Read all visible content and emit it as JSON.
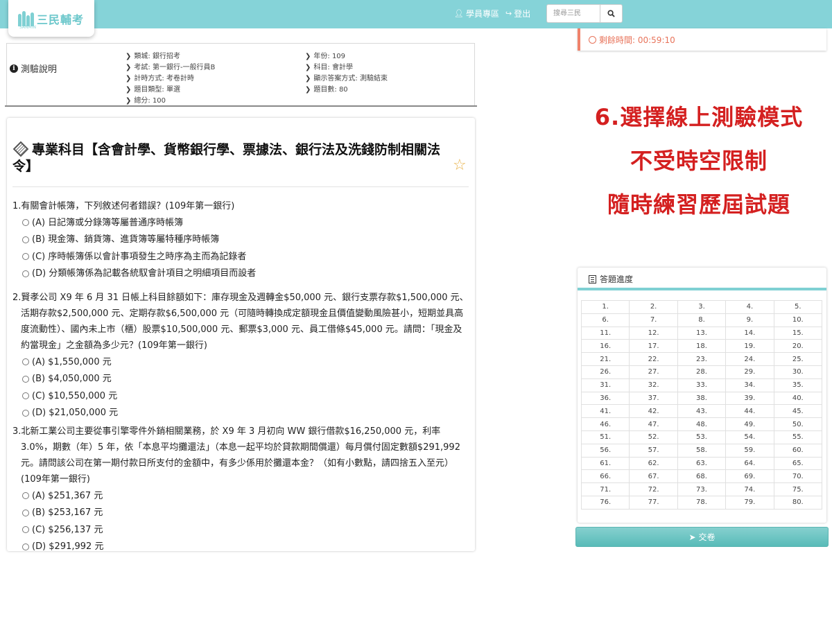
{
  "nav": {
    "logo_text": "三民輔考",
    "logo_sub": "SANMIN",
    "member_label": "學員專區",
    "logout_label": "登出",
    "search_placeholder": "搜尋三民",
    "colors": {
      "bar": "#85d3d8",
      "logo": "#6bc7cb"
    }
  },
  "info": {
    "title": "測驗說明",
    "left_items": [
      "類城: 銀行招考",
      "考試: 第一銀行-一般行員B",
      "計時方式: 考卷計時",
      "題目類型: 單選",
      "總分: 100"
    ],
    "right_items": [
      "年份: 109",
      "科目: 會計學",
      "顯示答案方式: 測驗結束",
      "題目數: 80"
    ]
  },
  "section": {
    "heading": "專業科目【含會計學、貨幣銀行學、票據法、銀行法及洗錢防制相關法令】",
    "star": "☆"
  },
  "questions": [
    {
      "text": "1.有關會計帳簿，下列敘述何者錯誤？(109年第一銀行)",
      "options": [
        "(A) 日記簿或分錄簿等屬普通序時帳簿",
        "(B) 現金簿、銷貨簿、進貨簿等屬特種序時帳簿",
        "(C) 序時帳簿係以會計事項發生之時序為主而為記錄者",
        "(D) 分類帳簿係為記載各統馭會計項目之明細項目而設者"
      ]
    },
    {
      "text": "2.賢孝公司 X9 年 6 月 31 日帳上科目餘額如下：庫存現金及週轉金$50,000 元、銀行支票存款$1,500,000 元、活期存款$2,500,000 元、定期存款$6,500,000 元（可隨時轉換成定額現金且價值變動風險甚小，短期並具高度流動性）、國內未上市（櫃）股票$10,500,000 元、郵票$3,000 元、員工借條$45,000 元。請問：「現金及約當現金」之金額為多少元？(109年第一銀行)",
      "options": [
        "(A) $1,550,000 元",
        "(B) $4,050,000 元",
        "(C) $10,550,000 元",
        "(D) $21,050,000 元"
      ]
    },
    {
      "text": "3.北新工業公司主要從事引擎零件外銷相關業務，於 X9 年 3 月初向 WW 銀行借款$16,250,000 元，利率 3.0%，期數（年）5 年，依「本息平均攤還法」（本息一起平均於貸款期間償還）每月償付固定數額$291,992 元。請問該公司在第一期付款日所支付的金額中，有多少係用於攤還本金？（如有小數點，請四捨五入至元）(109年第一銀行)",
      "options": [
        "(A) $251,367 元",
        "(B) $253,167 元",
        "(C) $256,137 元",
        "(D) $291,992 元"
      ]
    }
  ],
  "timer": {
    "label": "剩餘時間: 00:59:10",
    "color": "#e8735a"
  },
  "promo": {
    "lines": [
      "6.選擇線上測驗模式",
      "不受時空限制",
      "隨時練習歷屆試題"
    ],
    "color": "#d42020"
  },
  "progress": {
    "title": "答題進度",
    "total": 80,
    "columns": 5
  },
  "submit": {
    "label": "交卷"
  }
}
